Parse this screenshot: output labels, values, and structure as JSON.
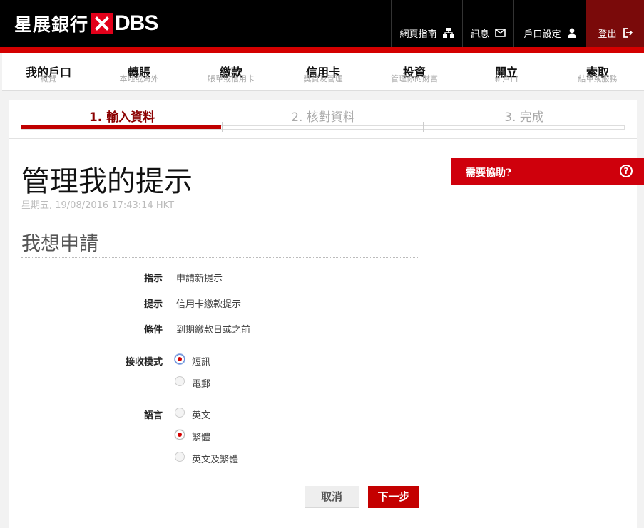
{
  "brand": {
    "name_cn": "星展銀行",
    "name_en": "DBS",
    "logo_color": "#e2001a",
    "accent": "#d40000"
  },
  "header": {
    "utility_nav": [
      {
        "label": "網頁指南",
        "icon": "sitemap-icon"
      },
      {
        "label": "訊息",
        "icon": "mail-icon"
      },
      {
        "label": "戶口設定",
        "icon": "user-icon"
      },
      {
        "label": "登出",
        "icon": "logout-icon"
      }
    ]
  },
  "main_nav": [
    {
      "label": "我的戶口",
      "sub": "概覽"
    },
    {
      "label": "轉賬",
      "sub": "本地或海外"
    },
    {
      "label": "繳款",
      "sub": "賬單或信用卡"
    },
    {
      "label": "信用卡",
      "sub": "獎賞及管理"
    },
    {
      "label": "投資",
      "sub": "管理你的財富"
    },
    {
      "label": "開立",
      "sub": "新戶口"
    },
    {
      "label": "索取",
      "sub": "結單或服務"
    }
  ],
  "steps": [
    {
      "label": "1. 輸入資料",
      "active": true
    },
    {
      "label": "2. 核對資料",
      "active": false
    },
    {
      "label": "3. 完成",
      "active": false
    }
  ],
  "page": {
    "title": "管理我的提示",
    "timestamp": "星期五, 19/08/2016 17:43:14 HKT",
    "section_title": "我想申請"
  },
  "form": {
    "instruction": {
      "label": "指示",
      "value": "申請新提示"
    },
    "alert": {
      "label": "提示",
      "value": "信用卡繳款提示"
    },
    "condition": {
      "label": "條件",
      "value": "到期繳款日或之前"
    },
    "receive_mode": {
      "label": "接收模式",
      "options": [
        {
          "label": "短訊",
          "selected": true
        },
        {
          "label": "電郵",
          "selected": false
        }
      ]
    },
    "language": {
      "label": "語言",
      "options": [
        {
          "label": "英文",
          "selected": false
        },
        {
          "label": "繁體",
          "selected": true
        },
        {
          "label": "英文及繁體",
          "selected": false
        }
      ]
    }
  },
  "buttons": {
    "cancel": "取消",
    "next": "下一步"
  },
  "help": {
    "label": "需要協助?",
    "icon": "question-circle-icon"
  }
}
